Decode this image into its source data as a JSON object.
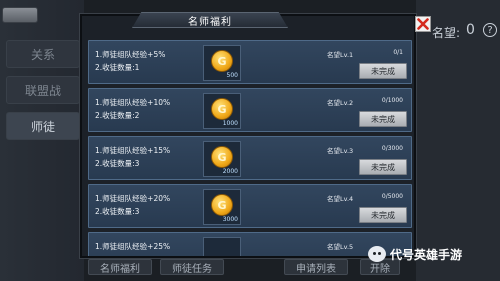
{
  "background": {
    "sidebar_items": [
      "关系",
      "联盟战",
      "师徒"
    ],
    "rank_label": "名望:",
    "rank_value": "0",
    "help_icon": "?",
    "bottom_buttons": [
      "名师福利",
      "师徒任务",
      "申请列表",
      "开除"
    ]
  },
  "dialog": {
    "title": "名师福利",
    "close_icon": "close-x-icon",
    "tasks": [
      {
        "line1": "1.师徒组队经验+5%",
        "line2": "2.收徒数量:1",
        "reward": "500",
        "rank": "名望Lv.1",
        "progress": "0/1",
        "status": "未完成"
      },
      {
        "line1": "1.师徒组队经验+10%",
        "line2": "2.收徒数量:2",
        "reward": "1000",
        "rank": "名望Lv.2",
        "progress": "0/1000",
        "status": "未完成"
      },
      {
        "line1": "1.师徒组队经验+15%",
        "line2": "2.收徒数量:3",
        "reward": "2000",
        "rank": "名望Lv.3",
        "progress": "0/3000",
        "status": "未完成"
      },
      {
        "line1": "1.师徒组队经验+20%",
        "line2": "2.收徒数量:3",
        "reward": "3000",
        "rank": "名望Lv.4",
        "progress": "0/5000",
        "status": "未完成"
      },
      {
        "line1": "1.师徒组队经验+25%",
        "line2": "",
        "reward": "",
        "rank": "名望Lv.5",
        "progress": "",
        "status": ""
      }
    ]
  },
  "watermark": {
    "text": "代号英雄手游"
  }
}
